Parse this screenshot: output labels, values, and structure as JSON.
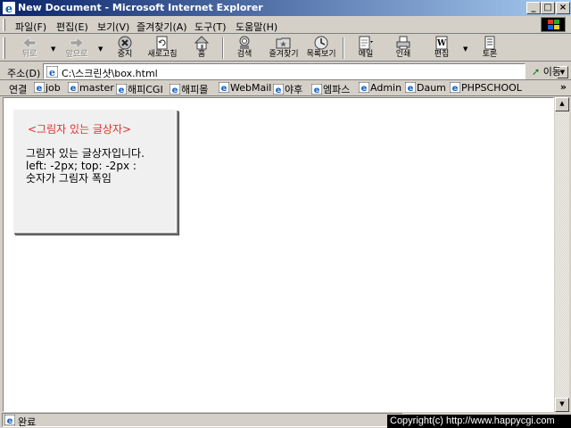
{
  "window": {
    "title": "New Document - Microsoft Internet Explorer",
    "minimize": "_",
    "maximize": "□",
    "close": "×"
  },
  "menu": {
    "items": [
      "파일(F)",
      "편집(E)",
      "보기(V)",
      "즐겨찾기(A)",
      "도구(T)",
      "도움말(H)"
    ]
  },
  "toolbar": {
    "back": "뒤로",
    "forward": "앞으로",
    "stop": "중지",
    "refresh": "새로고침",
    "home": "홈",
    "search": "검색",
    "favorites": "즐겨찾기",
    "history": "목록보기",
    "mail": "메일",
    "print": "인쇄",
    "edit": "편집",
    "discuss": "토론"
  },
  "address": {
    "label": "주소(D)",
    "value": "C:\\스크린샷\\box.html",
    "go": "이동"
  },
  "links": {
    "label": "연결",
    "items": [
      "job",
      "master",
      "해피CGI",
      "해피몰",
      "WebMail",
      "야후",
      "엠파스",
      "Admin",
      "Daum",
      "PHPSCHOOL"
    ],
    "more": "»"
  },
  "content": {
    "box_title": "<그림자 있는 글상자>",
    "box_lines": [
      "그림자 있는 글상자입니다.",
      "left: -2px; top: -2px :",
      "숫자가 그림자 폭임"
    ]
  },
  "status": {
    "text": "완료",
    "copyright": "Copyright(c) http://www.happycgi.com"
  },
  "colors": {
    "titlebar_start": "#0a246a",
    "titlebar_end": "#a6caf0",
    "chrome": "#d4d0c8",
    "box_title": "#e03030",
    "box_bg": "#f0f0f0"
  },
  "icons": {
    "window": "ie-logo-icon",
    "back": "back-arrow-icon",
    "forward": "forward-arrow-icon",
    "stop": "stop-icon",
    "refresh": "refresh-icon",
    "home": "home-icon",
    "search": "search-icon",
    "favorites": "favorites-folder-icon",
    "history": "history-icon",
    "mail": "mail-icon",
    "print": "printer-icon",
    "edit": "edit-document-icon",
    "discuss": "discuss-icon"
  }
}
